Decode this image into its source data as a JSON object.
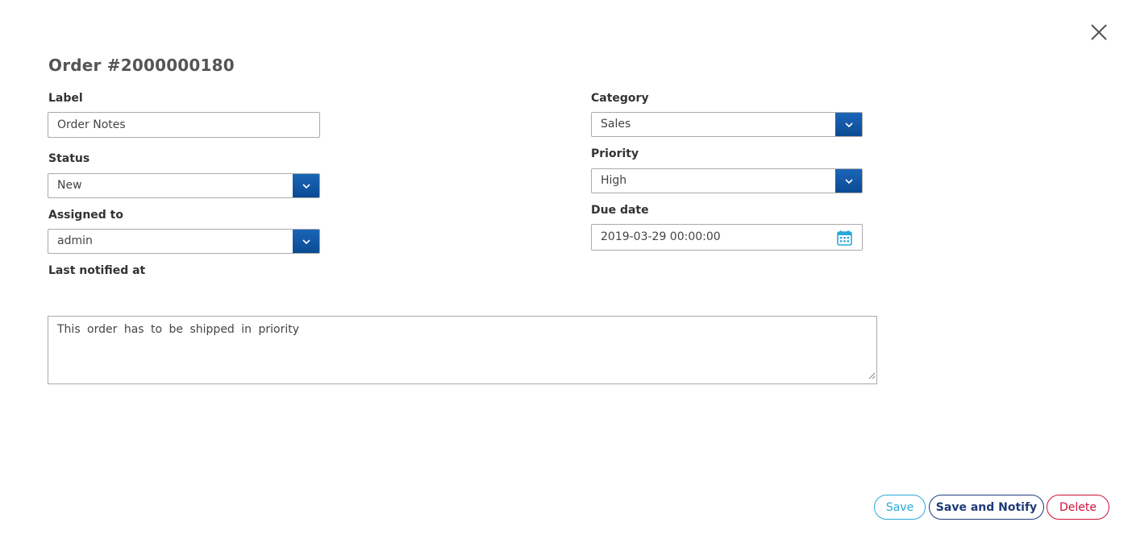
{
  "dialog": {
    "title": "Order #2000000180"
  },
  "form": {
    "label": {
      "caption": "Label",
      "value": "Order Notes"
    },
    "status": {
      "caption": "Status",
      "value": "New"
    },
    "assigned_to": {
      "caption": "Assigned to",
      "value": "admin"
    },
    "last_notified": {
      "caption": "Last notified at"
    },
    "category": {
      "caption": "Category",
      "value": "Sales"
    },
    "priority": {
      "caption": "Priority",
      "value": "High"
    },
    "due_date": {
      "caption": "Due date",
      "value": "2019-03-29 00:00:00"
    },
    "notes": {
      "value": "This order has to be shipped in priority"
    }
  },
  "actions": {
    "save": "Save",
    "save_notify": "Save and Notify",
    "delete": "Delete"
  },
  "colors": {
    "select_arrow": "#0b4a93",
    "save": "#2aa8d8",
    "save_notify": "#1f3a7a",
    "delete": "#d0103a",
    "calendar": "#2aa8d8"
  },
  "icons": {
    "close": "close-icon",
    "dropdown": "chevron-down-icon",
    "calendar": "calendar-icon",
    "resize": "resize-grip-icon"
  }
}
